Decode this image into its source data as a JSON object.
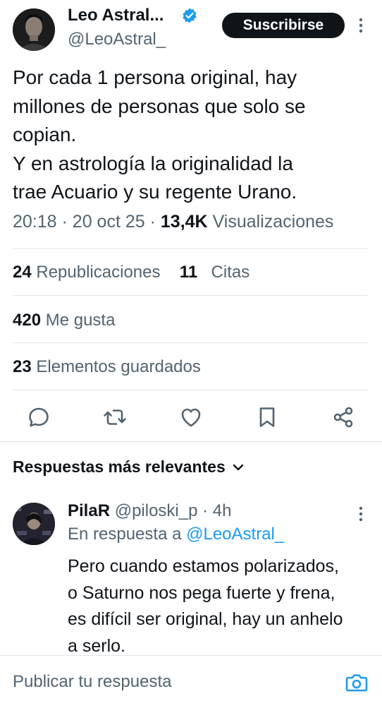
{
  "tweet": {
    "author_name": "Leo Astral...",
    "author_handle": "@LeoAstral_",
    "subscribe_label": "Suscribirse",
    "text_lines": [
      "Por cada 1 persona original, hay",
      "millones de personas que solo se",
      "copian.",
      "Y en astrología la originalidad la",
      "trae Acuario y su regente Urano."
    ],
    "time": "20:18",
    "date": "20 oct 25",
    "views_count": "13,4K",
    "views_label": "Visualizaciones"
  },
  "stats": {
    "reposts_count": "24",
    "reposts_label": "Republicaciones",
    "quotes_count": "11",
    "quotes_label": "Citas",
    "likes_count": "420",
    "likes_label": "Me gusta",
    "bookmarks_count": "23",
    "bookmarks_label": "Elementos guardados"
  },
  "actions": [
    "reply-icon",
    "retweet-icon",
    "heart-icon",
    "bookmark-icon",
    "share-icon"
  ],
  "replies": {
    "sort_label": "Respuestas más relevantes",
    "items": [
      {
        "name": "PilaR",
        "handle": "@piloski_p",
        "time": "4h",
        "reply_to_prefix": "En respuesta a",
        "reply_to_handle": "@LeoAstral_",
        "text_lines": [
          "Pero cuando estamos polarizados,",
          "o Saturno nos pega fuerte y frena,",
          "es difícil ser original, hay un anhelo",
          "a serlo."
        ]
      }
    ]
  },
  "composer": {
    "placeholder": "Publicar tu respuesta"
  },
  "colors": {
    "text": "#0f1419",
    "secondary": "#536471",
    "accent": "#1d9bf0",
    "divider": "#e1e6ea"
  }
}
